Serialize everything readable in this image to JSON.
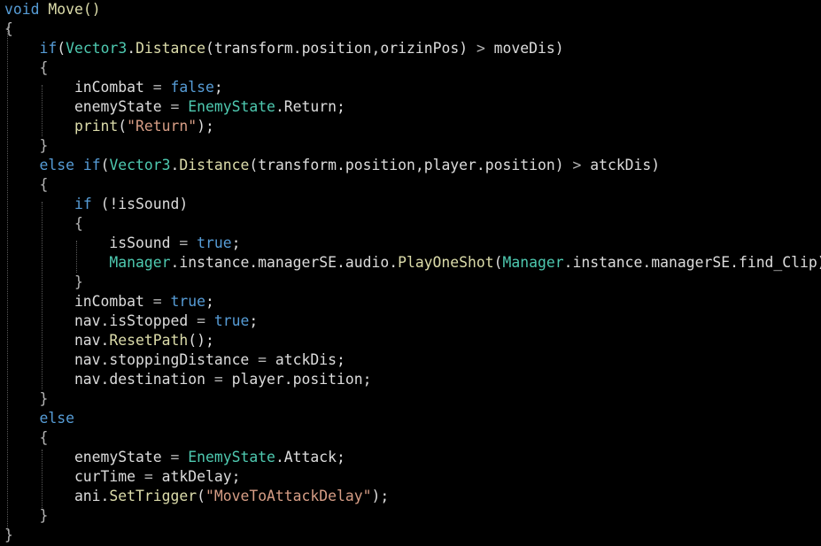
{
  "lines": [
    [
      {
        "t": "void",
        "c": "kw"
      },
      {
        "t": " Move()",
        "c": "fn"
      }
    ],
    [
      {
        "t": "{",
        "c": "pun"
      }
    ],
    [
      {
        "t": "    "
      },
      {
        "t": "if",
        "c": "kw"
      },
      {
        "t": "("
      },
      {
        "t": "Vector3",
        "c": "typ"
      },
      {
        "t": "."
      },
      {
        "t": "Distance",
        "c": "fn"
      },
      {
        "t": "(transform.position,orizinPos) "
      },
      {
        "t": ">",
        "c": "pun"
      },
      {
        "t": " moveDis)"
      }
    ],
    [
      {
        "t": "    "
      },
      {
        "t": "{",
        "c": "pun"
      }
    ],
    [
      {
        "t": "        inCombat "
      },
      {
        "t": "=",
        "c": "pun"
      },
      {
        "t": " "
      },
      {
        "t": "false",
        "c": "kw"
      },
      {
        "t": ";"
      }
    ],
    [
      {
        "t": "        enemyState "
      },
      {
        "t": "=",
        "c": "pun"
      },
      {
        "t": " "
      },
      {
        "t": "EnemyState",
        "c": "typ"
      },
      {
        "t": ".Return;"
      }
    ],
    [
      {
        "t": "        "
      },
      {
        "t": "print",
        "c": "fn"
      },
      {
        "t": "("
      },
      {
        "t": "\"Return\"",
        "c": "str"
      },
      {
        "t": ");"
      }
    ],
    [
      {
        "t": "    "
      },
      {
        "t": "}",
        "c": "pun"
      }
    ],
    [
      {
        "t": "    "
      },
      {
        "t": "else if",
        "c": "kw"
      },
      {
        "t": "("
      },
      {
        "t": "Vector3",
        "c": "typ"
      },
      {
        "t": "."
      },
      {
        "t": "Distance",
        "c": "fn"
      },
      {
        "t": "(transform.position,player.position) "
      },
      {
        "t": ">",
        "c": "pun"
      },
      {
        "t": " atckDis)"
      }
    ],
    [
      {
        "t": "    "
      },
      {
        "t": "{",
        "c": "pun"
      }
    ],
    [
      {
        "t": "        "
      },
      {
        "t": "if",
        "c": "kw"
      },
      {
        "t": " (!isSound)"
      }
    ],
    [
      {
        "t": "        "
      },
      {
        "t": "{",
        "c": "pun"
      }
    ],
    [
      {
        "t": "            isSound "
      },
      {
        "t": "=",
        "c": "pun"
      },
      {
        "t": " "
      },
      {
        "t": "true",
        "c": "kw"
      },
      {
        "t": ";"
      }
    ],
    [
      {
        "t": "            "
      },
      {
        "t": "Manager",
        "c": "typ"
      },
      {
        "t": ".instance.managerSE.audio."
      },
      {
        "t": "PlayOneShot",
        "c": "fn"
      },
      {
        "t": "("
      },
      {
        "t": "Manager",
        "c": "typ"
      },
      {
        "t": ".instance.managerSE.find_Clip);"
      }
    ],
    [
      {
        "t": "        "
      },
      {
        "t": "}",
        "c": "pun"
      }
    ],
    [
      {
        "t": "        inCombat "
      },
      {
        "t": "=",
        "c": "pun"
      },
      {
        "t": " "
      },
      {
        "t": "true",
        "c": "kw"
      },
      {
        "t": ";"
      }
    ],
    [
      {
        "t": "        nav.isStopped "
      },
      {
        "t": "=",
        "c": "pun"
      },
      {
        "t": " "
      },
      {
        "t": "true",
        "c": "kw"
      },
      {
        "t": ";"
      }
    ],
    [
      {
        "t": "        nav."
      },
      {
        "t": "ResetPath",
        "c": "fn"
      },
      {
        "t": "();"
      }
    ],
    [
      {
        "t": "        nav.stoppingDistance "
      },
      {
        "t": "=",
        "c": "pun"
      },
      {
        "t": " atckDis;"
      }
    ],
    [
      {
        "t": "        nav.destination "
      },
      {
        "t": "=",
        "c": "pun"
      },
      {
        "t": " player.position;"
      }
    ],
    [
      {
        "t": "    "
      },
      {
        "t": "}",
        "c": "pun"
      }
    ],
    [
      {
        "t": "    "
      },
      {
        "t": "else",
        "c": "kw"
      }
    ],
    [
      {
        "t": "    "
      },
      {
        "t": "{",
        "c": "pun"
      }
    ],
    [
      {
        "t": "        enemyState "
      },
      {
        "t": "=",
        "c": "pun"
      },
      {
        "t": " "
      },
      {
        "t": "EnemyState",
        "c": "typ"
      },
      {
        "t": ".Attack;"
      }
    ],
    [
      {
        "t": "        curTime "
      },
      {
        "t": "=",
        "c": "pun"
      },
      {
        "t": " atkDelay;"
      }
    ],
    [
      {
        "t": "        ani."
      },
      {
        "t": "SetTrigger",
        "c": "fn"
      },
      {
        "t": "("
      },
      {
        "t": "\"MoveToAttackDelay\"",
        "c": "str"
      },
      {
        "t": ");"
      }
    ],
    [
      {
        "t": "    "
      },
      {
        "t": "}",
        "c": "pun"
      }
    ],
    [
      {
        "t": "}",
        "c": "pun"
      }
    ]
  ]
}
